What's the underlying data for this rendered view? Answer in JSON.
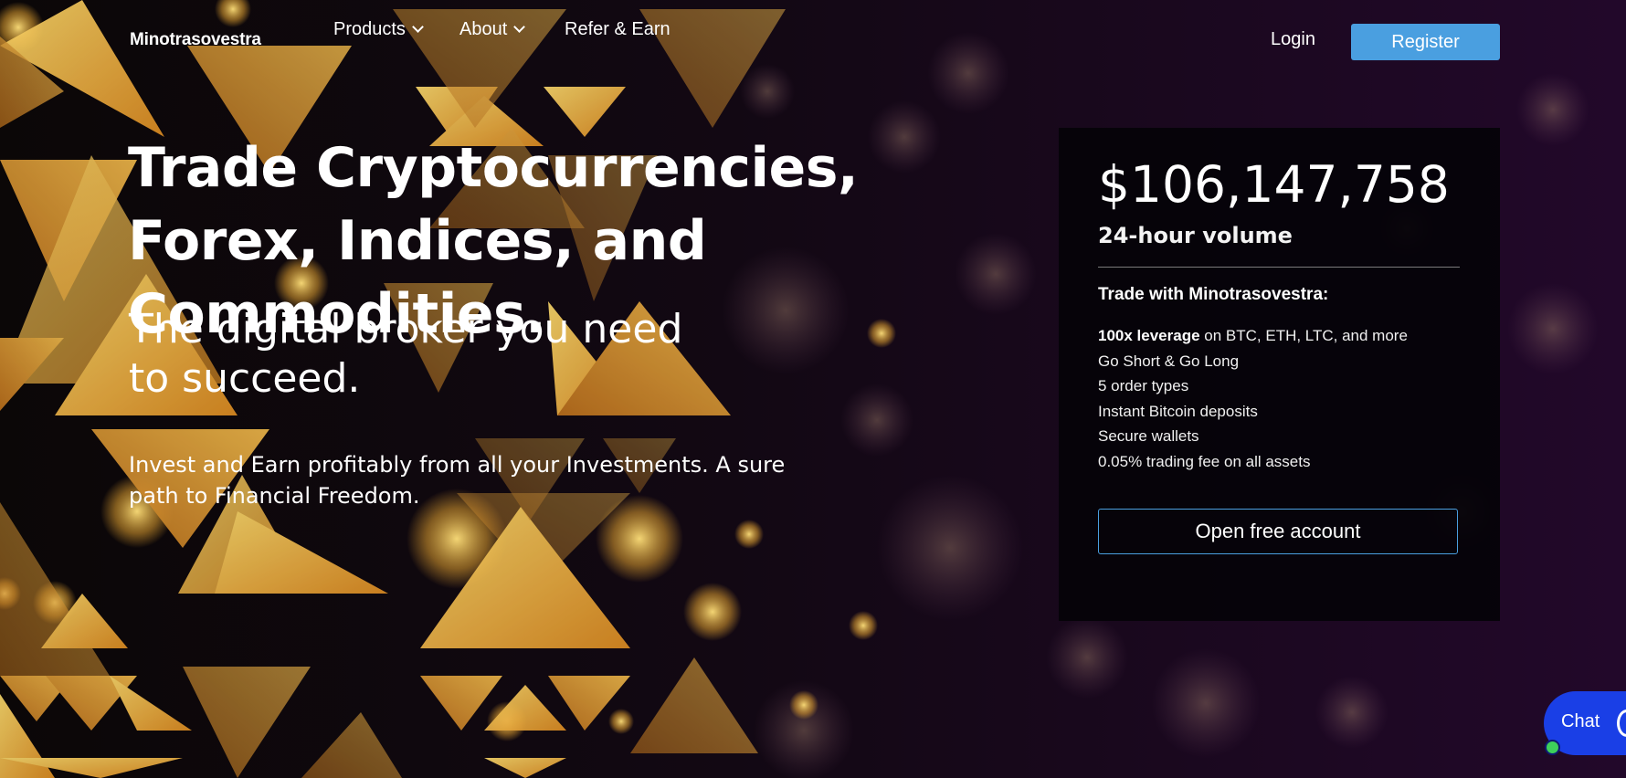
{
  "nav": {
    "brand": "Minotrasovestra",
    "menu": [
      {
        "label": "Products",
        "has_dropdown": true
      },
      {
        "label": "About",
        "has_dropdown": true
      },
      {
        "label": "Refer & Earn",
        "has_dropdown": false
      }
    ],
    "login_label": "Login",
    "register_label": "Register"
  },
  "hero": {
    "title": "Trade Cryptocurrencies, Forex, Indices, and Commodities.",
    "subtitle": "The digital broker you need to succeed.",
    "description": "Invest and Earn profitably from all your Investments. A sure path to Financial Freedom."
  },
  "stats": {
    "volume": "$106,147,758",
    "volume_label": "24-hour volume",
    "trade_heading": "Trade with Minotrasovestra:",
    "features": [
      {
        "bold": "100x leverage",
        "text": " on BTC, ETH, LTC, and more"
      },
      {
        "bold": "",
        "text": "Go Short & Go Long"
      },
      {
        "bold": "",
        "text": "5 order types"
      },
      {
        "bold": "",
        "text": "Instant Bitcoin deposits"
      },
      {
        "bold": "",
        "text": "Secure wallets"
      },
      {
        "bold": "",
        "text": "0.05% trading fee on all assets"
      }
    ],
    "cta_label": "Open free account"
  },
  "chat": {
    "label": "Chat",
    "status": "online"
  },
  "colors": {
    "accent_blue": "#4a9fe0",
    "chat_blue": "#1a3fe6",
    "gold": "#e0a83a",
    "background": "#0a0410",
    "online_green": "#3ecf5a"
  },
  "icons": [
    "chevron-down-icon",
    "chat-bubble-icon",
    "online-status-dot"
  ]
}
